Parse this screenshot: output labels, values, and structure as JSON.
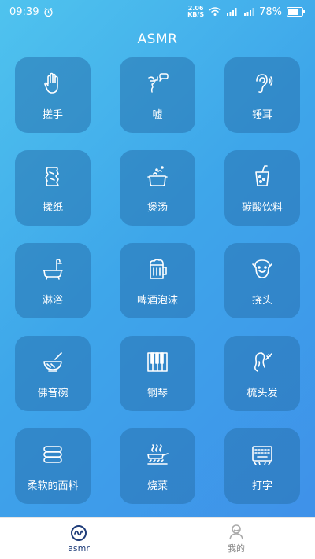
{
  "status_bar": {
    "time": "09:39",
    "alarm_icon": "alarm-clock-icon",
    "speed_value": "2.06",
    "speed_unit": "KB/S",
    "battery": "78%"
  },
  "app": {
    "title": "ASMR"
  },
  "tiles": [
    {
      "label": "搓手",
      "icon": "hand-icon"
    },
    {
      "label": "嘘",
      "icon": "whisper-icon"
    },
    {
      "label": "锤耳",
      "icon": "ear-icon"
    },
    {
      "label": "揉纸",
      "icon": "crumpled-paper-icon"
    },
    {
      "label": "煲汤",
      "icon": "soup-pot-icon"
    },
    {
      "label": "碳酸饮料",
      "icon": "soda-cup-icon"
    },
    {
      "label": "淋浴",
      "icon": "bathtub-icon"
    },
    {
      "label": "啤酒泡沫",
      "icon": "beer-mug-icon"
    },
    {
      "label": "挠头",
      "icon": "scratch-head-icon"
    },
    {
      "label": "佛音碗",
      "icon": "singing-bowl-icon"
    },
    {
      "label": "钢琴",
      "icon": "piano-icon"
    },
    {
      "label": "梳头发",
      "icon": "comb-hair-icon"
    },
    {
      "label": "柔软的面料",
      "icon": "fabric-stack-icon"
    },
    {
      "label": "烧菜",
      "icon": "frying-pan-icon"
    },
    {
      "label": "打字",
      "icon": "keyboard-icon"
    }
  ],
  "tab_bar": {
    "tabs": [
      {
        "label": "asmr",
        "icon": "asmr-wave-icon",
        "active": true
      },
      {
        "label": "我的",
        "icon": "profile-icon",
        "active": false
      }
    ]
  },
  "colors": {
    "accent": "#1f3d7a",
    "background_start": "#4fc3ee",
    "background_end": "#3f8fe9"
  }
}
